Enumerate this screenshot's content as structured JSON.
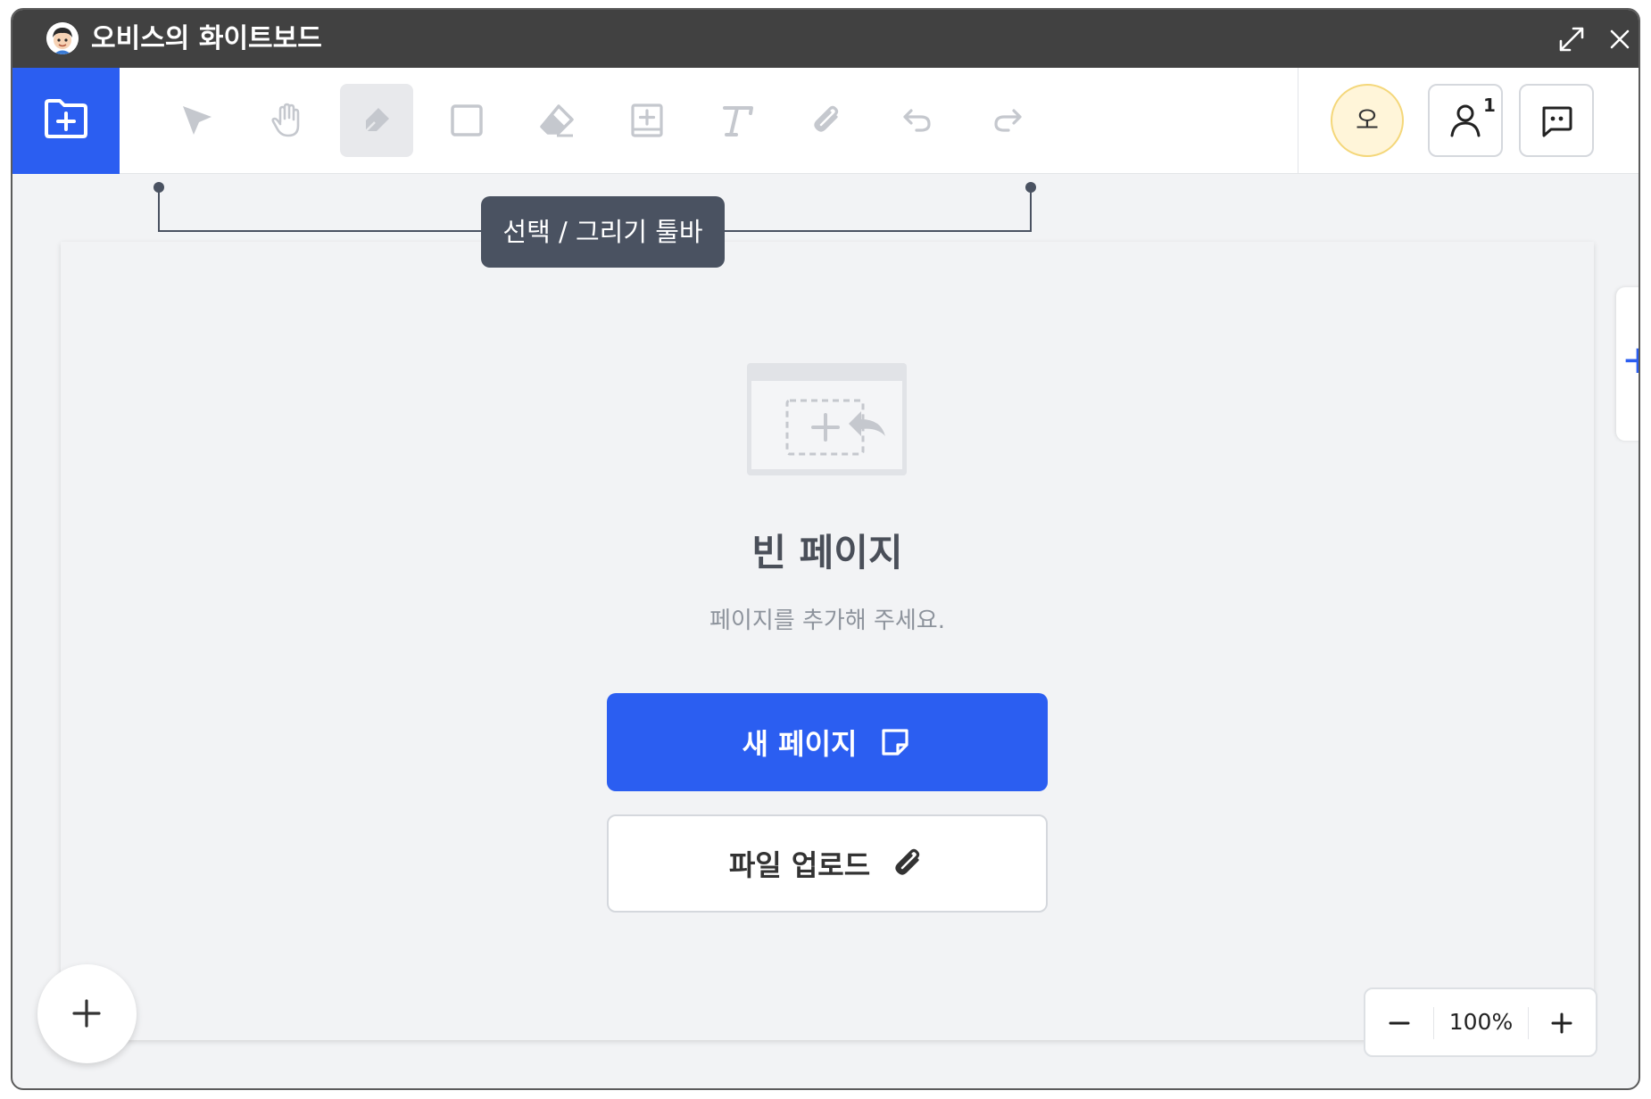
{
  "window": {
    "title": "오비스의 화이트보드"
  },
  "toolbar": {
    "tools": [
      "select-arrow-icon",
      "hand-icon",
      "pen-icon",
      "rectangle-icon",
      "eraser-icon",
      "add-box-icon",
      "text-icon",
      "attach-icon",
      "undo-icon",
      "redo-icon"
    ],
    "active_tool": "pen-icon",
    "avatar_initial": "오",
    "participant_count": "1"
  },
  "tooltip": {
    "label": "선택 / 그리기 툴바"
  },
  "empty_state": {
    "title": "빈 페이지",
    "subtitle": "페이지를 추가해 주세요.",
    "new_page_label": "새 페이지",
    "upload_label": "파일 업로드"
  },
  "zoom": {
    "value": "100%"
  },
  "colors": {
    "accent": "#2b5ef1",
    "titlebar": "#414141",
    "tooltip": "#4a5261"
  }
}
